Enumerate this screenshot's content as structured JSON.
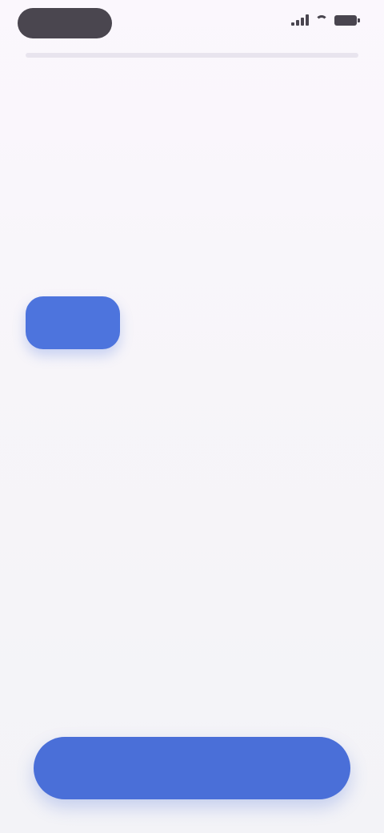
{
  "status_bar": {
    "time": "",
    "battery_percent": "",
    "icons": [
      "signal-icon",
      "wifi-icon",
      "battery-icon"
    ]
  },
  "progress": {
    "value": null
  },
  "main": {
    "title": "",
    "subtitle": "",
    "options": [
      "",
      "",
      ""
    ],
    "selected_button_label": "",
    "helper_text": ""
  },
  "footer": {
    "continue_label": ""
  },
  "colors": {
    "accent": "#4a6fd8",
    "background": "#f7f5f9",
    "status_pill": "#4a464f",
    "muted_text": "#9e99a6"
  }
}
